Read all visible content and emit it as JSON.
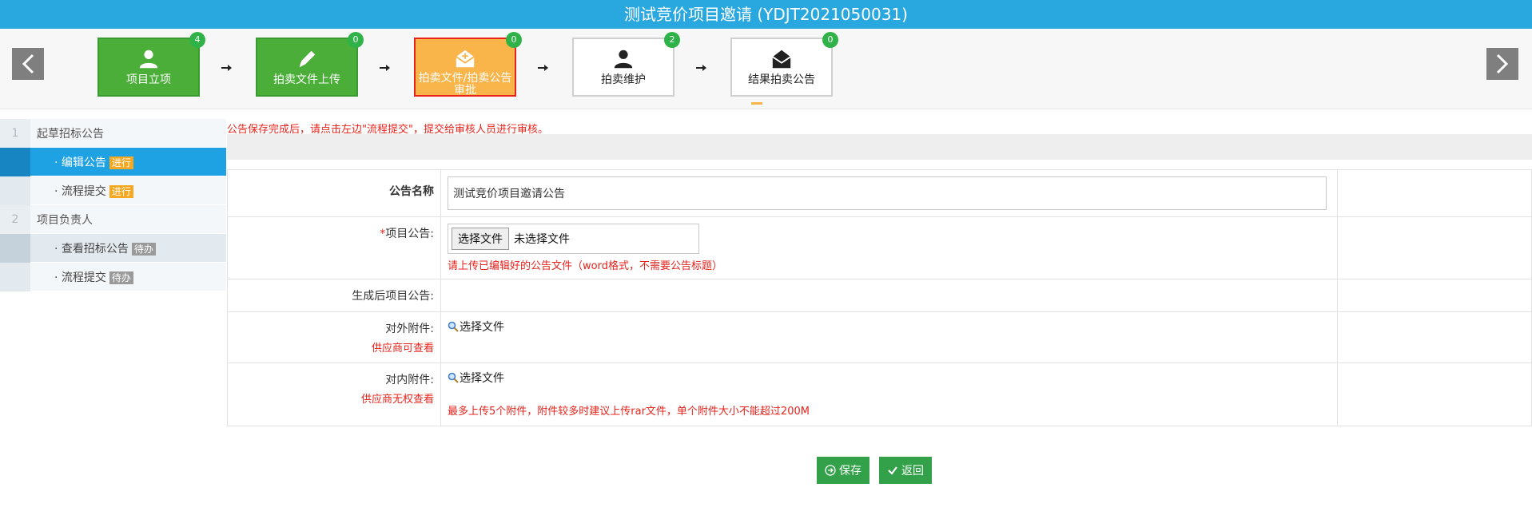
{
  "window": {
    "title": "测试竞价项目邀请 (YDJT2021050031)"
  },
  "steps": [
    {
      "label": "项目立项",
      "count": "4",
      "icon": "user-icon",
      "state": "done"
    },
    {
      "label": "拍卖文件上传",
      "count": "0",
      "icon": "pencil-icon",
      "state": "done"
    },
    {
      "label": "拍卖文件/拍卖公告审批",
      "count": "0",
      "icon": "mail-open-icon",
      "state": "active"
    },
    {
      "label": "拍卖维护",
      "count": "2",
      "icon": "user-icon",
      "state": "pending"
    },
    {
      "label": "结果拍卖公告",
      "count": "0",
      "icon": "envelope-icon",
      "state": "pending"
    }
  ],
  "sidebar": {
    "items": [
      {
        "num": "1",
        "label": "起草招标公告"
      },
      {
        "label": "· 编辑公告",
        "tag": "进行"
      },
      {
        "label": "· 流程提交",
        "tag": "进行"
      },
      {
        "num": "2",
        "label": "项目负责人"
      },
      {
        "label": "· 查看招标公告",
        "tag": "待办"
      },
      {
        "label": "· 流程提交",
        "tag": "待办"
      }
    ]
  },
  "notice": "公告保存完成后，请点击左边\"流程提交\"，提交给审核人员进行审核。",
  "form": {
    "title_label": "公告名称",
    "title_value": "测试竞价项目邀请公告",
    "project_notice_label": "项目公告:",
    "file_button": "选择文件",
    "file_status": "未选择文件",
    "file_hint": "请上传已编辑好的公告文件（word格式，不需要公告标题）",
    "generated_label": "生成后项目公告:",
    "external_label": "对外附件:",
    "external_sub": "供应商可查看",
    "external_choose": "选择文件",
    "internal_label": "对内附件:",
    "internal_sub": "供应商无权查看",
    "internal_choose": "选择文件",
    "attach_hint": "最多上传5个附件，附件较多时建议上传rar文件，单个附件大小不能超过200M"
  },
  "actions": {
    "save": "保存",
    "back": "返回"
  },
  "colors": {
    "title_bar": "#29a8e0",
    "done": "#4bae38",
    "active": "#f9b54a",
    "selected": "#1fa2e4",
    "error": "#e8231c"
  }
}
